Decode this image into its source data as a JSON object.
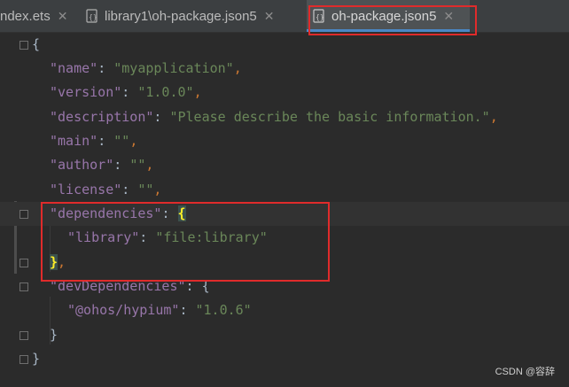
{
  "tabs": [
    {
      "label": "ndex.ets",
      "close": "✕"
    },
    {
      "label": "library1\\oh-package.json5",
      "close": "✕"
    },
    {
      "label": "oh-package.json5",
      "close": "✕"
    }
  ],
  "code": {
    "l1": {
      "brace": "{"
    },
    "l2": {
      "key": "\"name\"",
      "colon": ": ",
      "value": "\"myapplication\"",
      "comma": ","
    },
    "l3": {
      "key": "\"version\"",
      "colon": ": ",
      "value": "\"1.0.0\"",
      "comma": ","
    },
    "l4": {
      "key": "\"description\"",
      "colon": ": ",
      "value": "\"Please describe the basic information.\"",
      "comma": ","
    },
    "l5": {
      "key": "\"main\"",
      "colon": ": ",
      "value": "\"\"",
      "comma": ","
    },
    "l6": {
      "key": "\"author\"",
      "colon": ": ",
      "value": "\"\"",
      "comma": ","
    },
    "l7": {
      "key": "\"license\"",
      "colon": ": ",
      "value": "\"\"",
      "comma": ","
    },
    "l8": {
      "key": "\"dependencies\"",
      "colon": ": ",
      "brace": "{"
    },
    "l9": {
      "key": "\"library\"",
      "colon": ": ",
      "value": "\"file:library\""
    },
    "l10": {
      "brace": "}",
      "comma": ","
    },
    "l11": {
      "key": "\"devDependencies\"",
      "colon": ": ",
      "brace": "{"
    },
    "l12": {
      "key": "\"@ohos/hypium\"",
      "colon": ": ",
      "value": "\"1.0.6\""
    },
    "l13": {
      "brace": "}"
    },
    "l14": {
      "brace": "}"
    }
  },
  "watermark": "CSDN @容辞",
  "colors": {
    "key": "#9876aa",
    "string": "#6a8759",
    "punct": "#cc7832",
    "highlight_box": "#e02b2b",
    "tab_accent": "#4a88c7"
  }
}
